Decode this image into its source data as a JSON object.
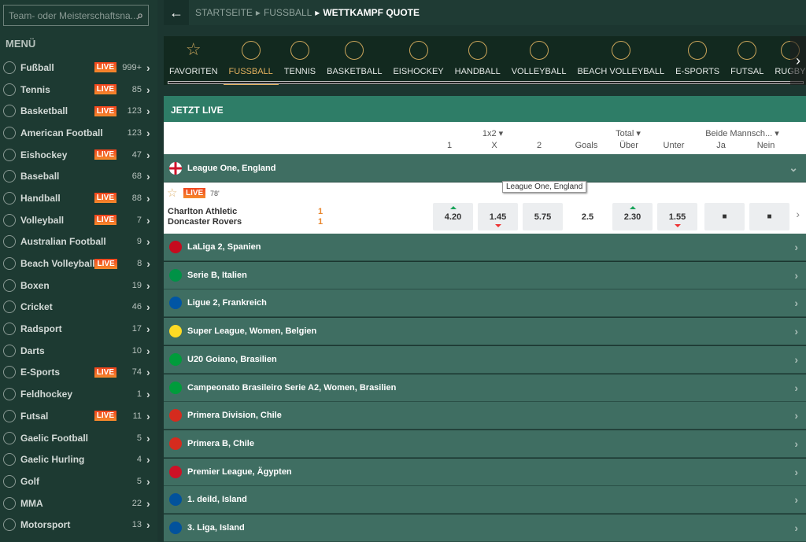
{
  "search": {
    "placeholder": "Team- oder Meisterschaftsna..."
  },
  "menu_title": "MENÜ",
  "sidebar": [
    {
      "label": "Fußball",
      "live": true,
      "count": "999+"
    },
    {
      "label": "Tennis",
      "live": true,
      "count": "85"
    },
    {
      "label": "Basketball",
      "live": true,
      "count": "123"
    },
    {
      "label": "American Football",
      "live": false,
      "count": "123"
    },
    {
      "label": "Eishockey",
      "live": true,
      "count": "47"
    },
    {
      "label": "Baseball",
      "live": false,
      "count": "68"
    },
    {
      "label": "Handball",
      "live": true,
      "count": "88"
    },
    {
      "label": "Volleyball",
      "live": true,
      "count": "7"
    },
    {
      "label": "Australian Football",
      "live": false,
      "count": "9"
    },
    {
      "label": "Beach Volleyball",
      "live": true,
      "count": "8"
    },
    {
      "label": "Boxen",
      "live": false,
      "count": "19"
    },
    {
      "label": "Cricket",
      "live": false,
      "count": "46"
    },
    {
      "label": "Radsport",
      "live": false,
      "count": "17"
    },
    {
      "label": "Darts",
      "live": false,
      "count": "10"
    },
    {
      "label": "E-Sports",
      "live": true,
      "count": "74"
    },
    {
      "label": "Feldhockey",
      "live": false,
      "count": "1"
    },
    {
      "label": "Futsal",
      "live": true,
      "count": "11"
    },
    {
      "label": "Gaelic Football",
      "live": false,
      "count": "5"
    },
    {
      "label": "Gaelic Hurling",
      "live": false,
      "count": "4"
    },
    {
      "label": "Golf",
      "live": false,
      "count": "5"
    },
    {
      "label": "MMA",
      "live": false,
      "count": "22"
    },
    {
      "label": "Motorsport",
      "live": false,
      "count": "13"
    }
  ],
  "live_label": "LIVE",
  "breadcrumb": [
    "STARTSEITE",
    "FUSSBALL",
    "WETTKAMPF QUOTE"
  ],
  "sport_tabs": [
    "FAVORITEN",
    "FUSSBALL",
    "TENNIS",
    "BASKETBALL",
    "EISHOCKEY",
    "HANDBALL",
    "VOLLEYBALL",
    "BEACH VOLLEYBALL",
    "E-SPORTS",
    "FUTSAL",
    "RUGBY"
  ],
  "active_tab": "FUSSBALL",
  "section_title": "JETZT LIVE",
  "columns": {
    "group1": "1x2 ▾",
    "group2": "Total ▾",
    "group3": "Beide Mannsch... ▾",
    "c1": "1",
    "cx": "X",
    "c2": "2",
    "goals": "Goals",
    "over": "Über",
    "under": "Unter",
    "yes": "Ja",
    "no": "Nein"
  },
  "match": {
    "league": "League One, England",
    "minute": "78'",
    "home": "Charlton Athletic",
    "away": "Doncaster Rovers",
    "home_score": "1",
    "away_score": "1",
    "odds": {
      "1": "4.20",
      "x": "1.45",
      "2": "5.75",
      "goals": "2.5",
      "over": "2.30",
      "under": "1.55"
    },
    "tooltip": "League One, England"
  },
  "leagues": [
    {
      "name": "LaLiga 2, Spanien",
      "flag": "#c60b1e"
    },
    {
      "name": "Serie B, Italien",
      "flag": "#009246"
    },
    {
      "name": "Ligue 2, Frankreich",
      "flag": "#0055a4"
    },
    {
      "name": "Super League, Women, Belgien",
      "flag": "#fdda24"
    },
    {
      "name": "U20 Goiano, Brasilien",
      "flag": "#009c3b"
    },
    {
      "name": "Campeonato Brasileiro Serie A2, Women, Brasilien",
      "flag": "#009c3b"
    },
    {
      "name": "Primera Division, Chile",
      "flag": "#d52b1e"
    },
    {
      "name": "Primera B, Chile",
      "flag": "#d52b1e"
    },
    {
      "name": "Premier League, Ägypten",
      "flag": "#ce1126"
    },
    {
      "name": "1. deild, Island",
      "flag": "#02529c"
    },
    {
      "name": "3. Liga, Island",
      "flag": "#02529c"
    }
  ],
  "colors": {
    "accent": "#e3b15e",
    "live_header": "#2e7d67",
    "league_row": "#3f6e62",
    "sidebar": "#1d3a32"
  }
}
